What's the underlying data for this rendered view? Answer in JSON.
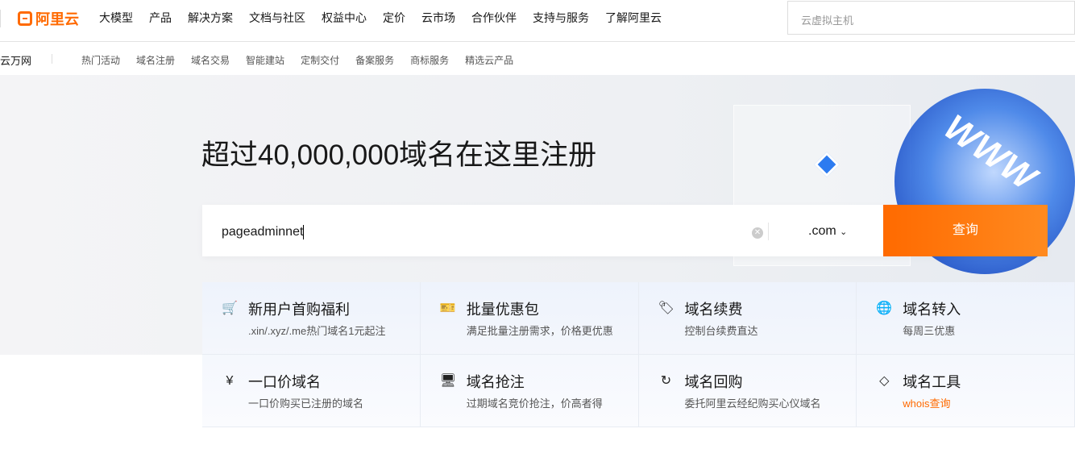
{
  "header": {
    "logo": "阿里云",
    "nav": [
      "大模型",
      "产品",
      "解决方案",
      "文档与社区",
      "权益中心",
      "定价",
      "云市场",
      "合作伙伴",
      "支持与服务",
      "了解阿里云"
    ],
    "search_placeholder": "云虚拟主机"
  },
  "subnav": {
    "brand": "云万网",
    "items": [
      "热门活动",
      "域名注册",
      "域名交易",
      "智能建站",
      "定制交付",
      "备案服务",
      "商标服务",
      "精选云产品"
    ]
  },
  "hero": {
    "title": "超过40,000,000域名在这里注册",
    "search_value": "pageadminnet",
    "tld": ".com",
    "button": "查询",
    "art_text": "WWW"
  },
  "cards": [
    {
      "icon": "cart-icon",
      "glyph": "🛒",
      "title": "新用户首购福利",
      "desc": ".xin/.xyz/.me热门域名1元起注",
      "accent": false
    },
    {
      "icon": "package-icon",
      "glyph": "🎫",
      "title": "批量优惠包",
      "desc": "满足批量注册需求，价格更优惠",
      "accent": false
    },
    {
      "icon": "tag-icon",
      "glyph": "🏷",
      "title": "域名续费",
      "desc": "控制台续费直达",
      "accent": false
    },
    {
      "icon": "globe-hand-icon",
      "glyph": "🌐",
      "title": "域名转入",
      "desc": "每周三优惠",
      "accent": false
    },
    {
      "icon": "price-tag-icon",
      "glyph": "¥",
      "title": "一口价域名",
      "desc": "一口价购买已注册的域名",
      "accent": false
    },
    {
      "icon": "www-monitor-icon",
      "glyph": "🖥",
      "title": "域名抢注",
      "desc": "过期域名竞价抢注，价高者得",
      "accent": false
    },
    {
      "icon": "buyback-icon",
      "glyph": "↻",
      "title": "域名回购",
      "desc": "委托阿里云经纪购买心仪域名",
      "accent": false
    },
    {
      "icon": "tool-icon",
      "glyph": "◇",
      "title": "域名工具",
      "desc": "whois查询",
      "accent": true
    }
  ]
}
